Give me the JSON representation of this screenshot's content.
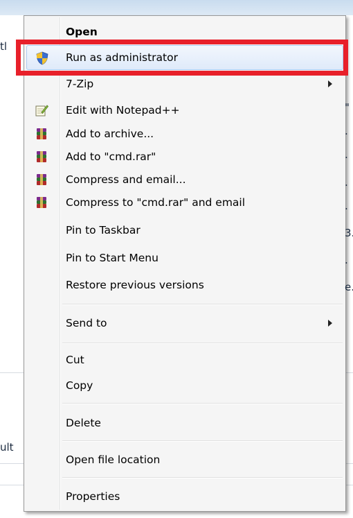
{
  "background": {
    "left_fragments": [
      "tl",
      "ult"
    ],
    "right_fragments": [
      "\"",
      ".",
      ".",
      ".",
      ".",
      "3.",
      ".",
      "e."
    ]
  },
  "menu": {
    "items": [
      {
        "label": "Open",
        "bold": true,
        "icon": "",
        "submenu": false
      },
      {
        "label": "Run as administrator",
        "icon": "uac-shield-icon",
        "highlighted": true,
        "submenu": false
      },
      {
        "label": "7-Zip",
        "icon": "",
        "submenu": true
      },
      {
        "label": "Edit with Notepad++",
        "icon": "notepad-icon",
        "submenu": false
      },
      {
        "label": "Add to archive...",
        "icon": "winrar-icon",
        "submenu": false
      },
      {
        "label": "Add to \"cmd.rar\"",
        "icon": "winrar-icon",
        "submenu": false
      },
      {
        "label": "Compress and email...",
        "icon": "winrar-icon",
        "submenu": false
      },
      {
        "label": "Compress to \"cmd.rar\" and email",
        "icon": "winrar-icon",
        "submenu": false
      },
      {
        "label": "Pin to Taskbar",
        "icon": "",
        "submenu": false
      },
      {
        "label": "Pin to Start Menu",
        "icon": "",
        "submenu": false
      },
      {
        "label": "Restore previous versions",
        "icon": "",
        "submenu": false
      },
      {
        "label": "Send to",
        "icon": "",
        "submenu": true
      },
      {
        "label": "Cut",
        "icon": "",
        "submenu": false
      },
      {
        "label": "Copy",
        "icon": "",
        "submenu": false
      },
      {
        "label": "Delete",
        "icon": "",
        "submenu": false
      },
      {
        "label": "Open file location",
        "icon": "",
        "submenu": false
      },
      {
        "label": "Properties",
        "icon": "",
        "submenu": false
      }
    ]
  },
  "colors": {
    "highlight_box": "#e8202a",
    "hover_border": "#aecbf0"
  }
}
